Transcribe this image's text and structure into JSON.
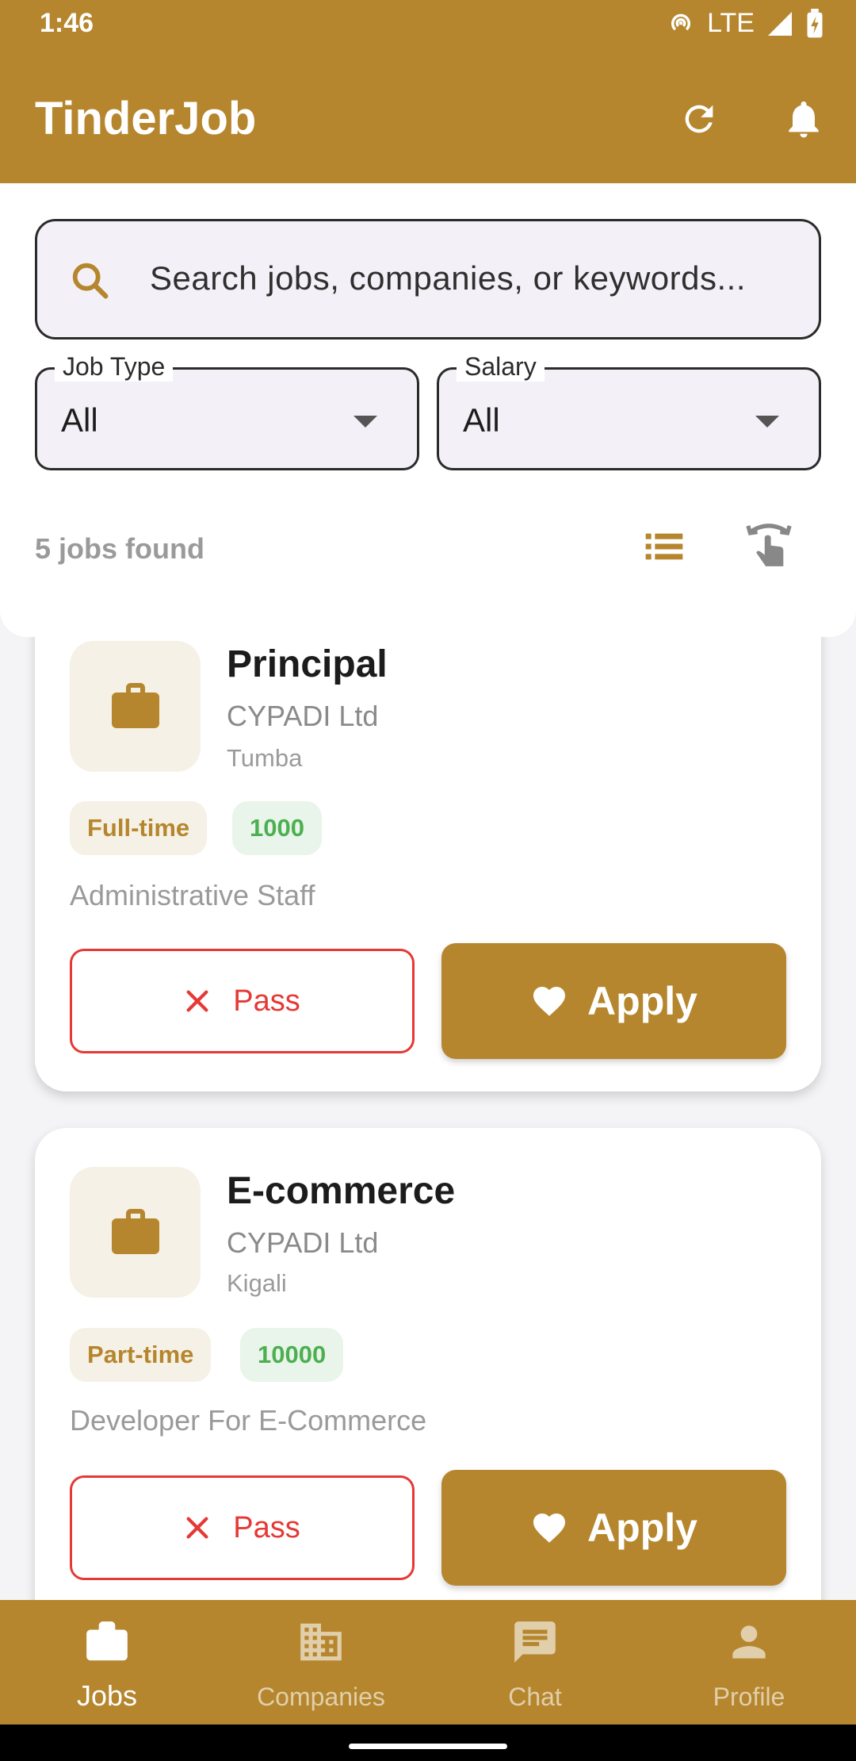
{
  "status": {
    "time": "1:46",
    "network": "LTE"
  },
  "app": {
    "title": "TinderJob"
  },
  "search": {
    "placeholder": "Search jobs, companies, or keywords..."
  },
  "filters": {
    "job_type": {
      "label": "Job Type",
      "value": "All"
    },
    "salary": {
      "label": "Salary",
      "value": "All"
    }
  },
  "results": {
    "count_text": "5 jobs found"
  },
  "jobs": [
    {
      "title": "Principal",
      "company": "CYPADI Ltd",
      "location": "Tumba",
      "type": "Full-time",
      "salary": "1000",
      "description": "Administrative Staff",
      "pass_label": "Pass",
      "apply_label": "Apply"
    },
    {
      "title": "E-commerce",
      "company": "CYPADI Ltd",
      "location": "Kigali",
      "type": "Part-time",
      "salary": "10000",
      "description": "Developer For E-Commerce",
      "pass_label": "Pass",
      "apply_label": "Apply"
    }
  ],
  "nav": {
    "items": [
      {
        "label": "Jobs",
        "icon": "briefcase-icon",
        "active": true
      },
      {
        "label": "Companies",
        "icon": "building-icon",
        "active": false
      },
      {
        "label": "Chat",
        "icon": "chat-icon",
        "active": false
      },
      {
        "label": "Profile",
        "icon": "person-icon",
        "active": false
      }
    ]
  },
  "colors": {
    "primary": "#b5862d",
    "pass": "#e53935",
    "salary": "#4caf50"
  }
}
